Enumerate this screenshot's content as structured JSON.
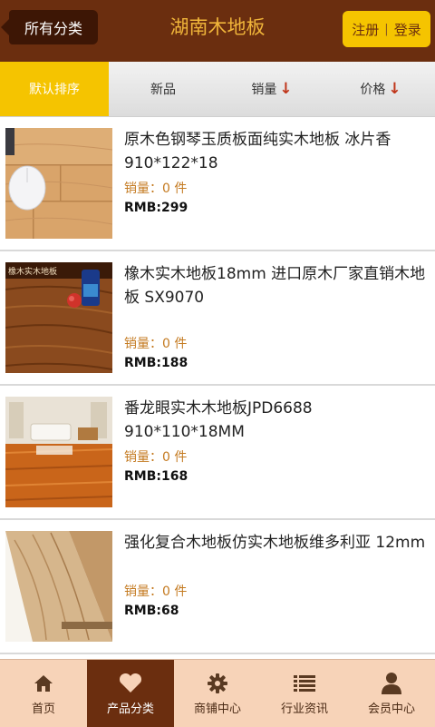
{
  "header": {
    "back_label": "所有分类",
    "title": "湖南木地板",
    "register_label": "注册",
    "separator": "|",
    "login_label": "登录"
  },
  "sort_tabs": [
    {
      "label": "默认排序",
      "active": true
    },
    {
      "label": "新品",
      "active": false
    },
    {
      "label": "销量",
      "arrow": "↓",
      "active": false
    },
    {
      "label": "价格",
      "arrow": "↓",
      "active": false
    }
  ],
  "products": [
    {
      "title": "原木色钢琴玉质板面纯实木地板 冰片香 910*122*18",
      "sales_label": "销量：",
      "sales_value": "0 件",
      "price": "RMB:299",
      "thumb_icon": "wood-floor-with-mouse-image"
    },
    {
      "title": "橡木实木地板18mm 进口原木厂家直销木地板 SX9070",
      "sales_label": "销量：",
      "sales_value": "0 件",
      "price": "RMB:188",
      "thumb_icon": "oak-floor-image",
      "thumb_caption": "橡木实木地板"
    },
    {
      "title": "番龙眼实木木地板JPD6688 910*110*18MM",
      "sales_label": "销量：",
      "sales_value": "0 件",
      "price": "RMB:168",
      "thumb_icon": "living-room-floor-image"
    },
    {
      "title": "强化复合木地板仿实木地板维多利亚 12mm",
      "sales_label": "销量：",
      "sales_value": "0 件",
      "price": "RMB:68",
      "thumb_icon": "laminate-plank-image"
    }
  ],
  "bottom_nav": [
    {
      "label": "首页",
      "icon": "home-icon",
      "active": false
    },
    {
      "label": "产品分类",
      "icon": "heart-icon",
      "active": true
    },
    {
      "label": "商铺中心",
      "icon": "gear-icon",
      "active": false
    },
    {
      "label": "行业资讯",
      "icon": "list-icon",
      "active": false
    },
    {
      "label": "会员中心",
      "icon": "user-icon",
      "active": false
    }
  ],
  "colors": {
    "header_bg": "#6b2e0f",
    "accent_yellow": "#f5c400",
    "title_orange": "#f0b53a",
    "sales_orange": "#c47a20",
    "nav_bg": "#f7d3b8"
  }
}
